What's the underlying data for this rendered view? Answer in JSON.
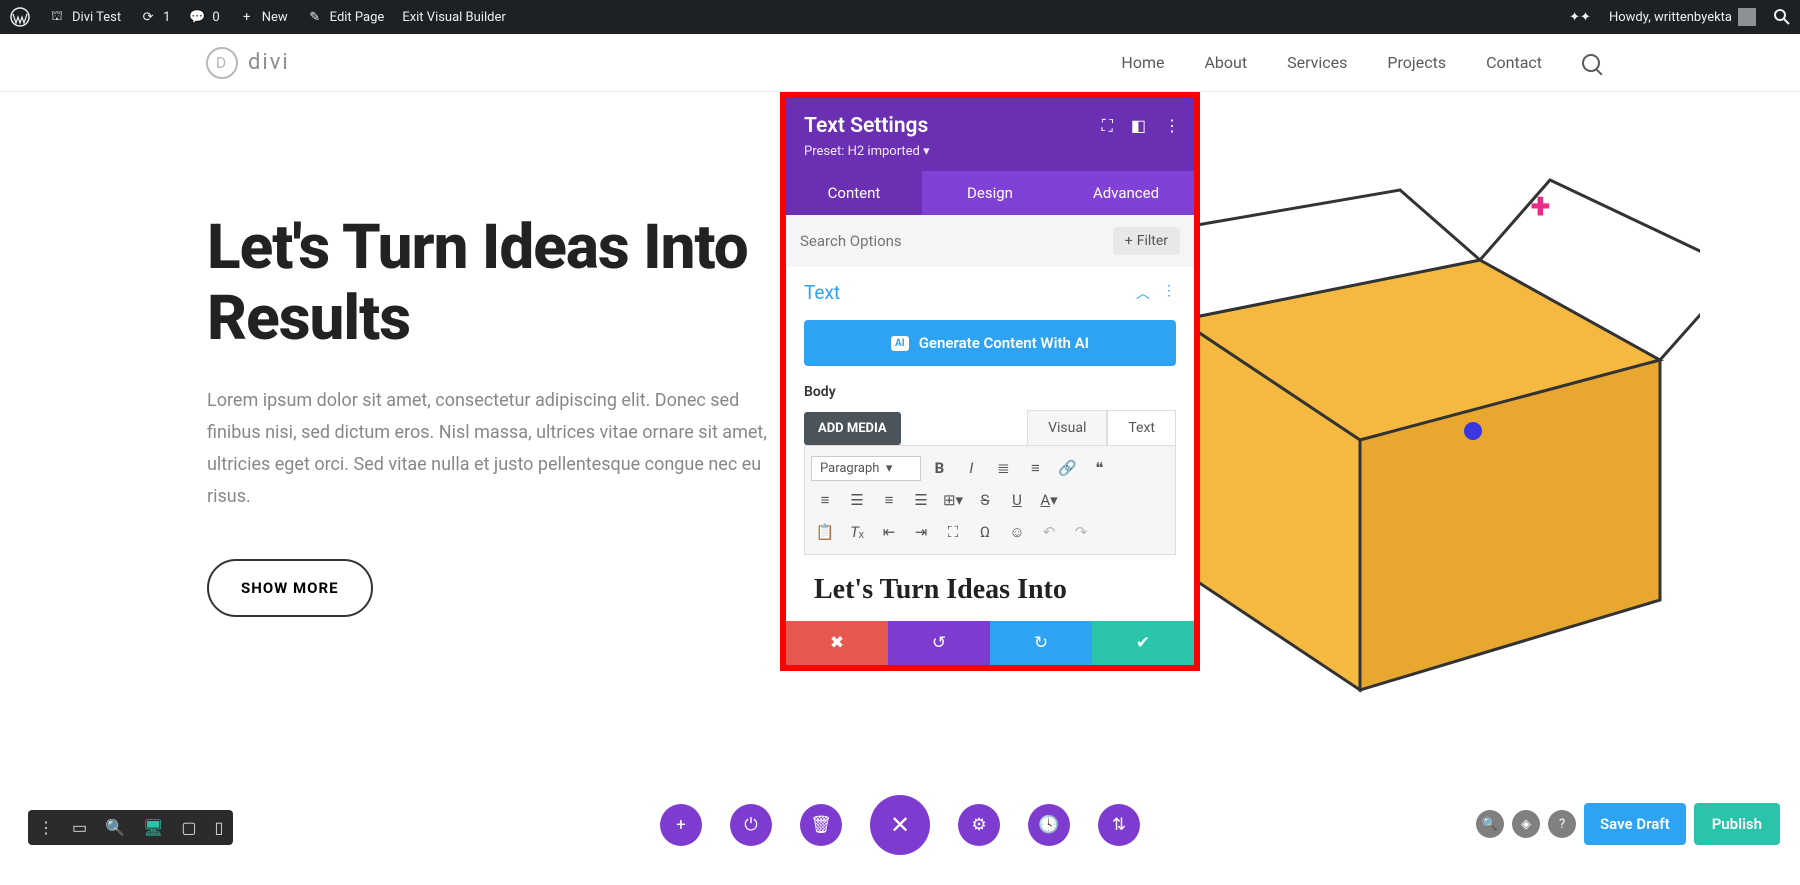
{
  "admin_bar": {
    "site_name": "Divi Test",
    "updates": "1",
    "comments": "0",
    "new": "New",
    "edit_page": "Edit Page",
    "exit_vb": "Exit Visual Builder",
    "howdy": "Howdy, writtenbyekta"
  },
  "site": {
    "logo_text": "divi",
    "nav": [
      "Home",
      "About",
      "Services",
      "Projects",
      "Contact"
    ]
  },
  "hero": {
    "title": "Let's Turn Ideas Into Results",
    "text": "Lorem ipsum dolor sit amet, consectetur adipiscing elit. Donec sed finibus nisi, sed dictum eros. Nisl massa, ultrices vitae ornare sit amet, ultricies eget orci. Sed vitae nulla et justo pellentesque congue nec eu risus.",
    "button": "SHOW MORE"
  },
  "panel": {
    "title": "Text Settings",
    "preset": "Preset: H2 imported",
    "tabs": {
      "content": "Content",
      "design": "Design",
      "advanced": "Advanced"
    },
    "search_placeholder": "Search Options",
    "filter": "Filter",
    "section": "Text",
    "ai_button": "Generate Content With AI",
    "ai_badge": "AI",
    "body_label": "Body",
    "add_media": "ADD MEDIA",
    "editor_tabs": {
      "visual": "Visual",
      "text": "Text"
    },
    "format": "Paragraph",
    "editor_content": "Let's Turn Ideas Into"
  },
  "bottom": {
    "save_draft": "Save Draft",
    "publish": "Publish"
  }
}
